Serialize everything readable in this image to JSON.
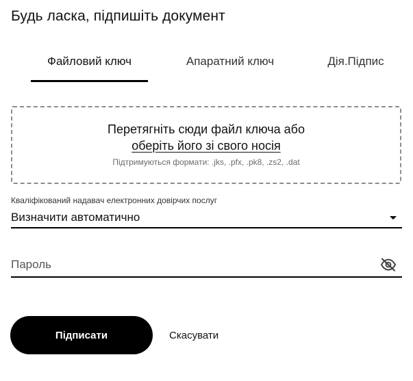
{
  "dialog": {
    "title": "Будь ласка, підпишіть документ"
  },
  "tabs": [
    {
      "label": "Файловий ключ",
      "active": true
    },
    {
      "label": "Апаратний ключ",
      "active": false
    },
    {
      "label": "Дія.Підпис",
      "active": false
    }
  ],
  "dropzone": {
    "line1": "Перетягніть сюди файл ключа або",
    "link": "оберіть його зі свого носія",
    "formats": "Підтримуються формати: .jks, .pfx, .pk8, .zs2, .dat"
  },
  "provider": {
    "label": "Кваліфікований надавач електронних довірчих послуг",
    "selected": "Визначити автоматично",
    "icon": "chevron-down-icon"
  },
  "password": {
    "placeholder": "Пароль",
    "value": "",
    "icon": "eye-off-icon"
  },
  "actions": {
    "sign_label": "Підписати",
    "cancel_label": "Скасувати"
  },
  "colors": {
    "accent": "#000000",
    "background": "#ffffff",
    "muted_text": "#6b6b6b",
    "dashed_border": "#8c8c8c"
  }
}
